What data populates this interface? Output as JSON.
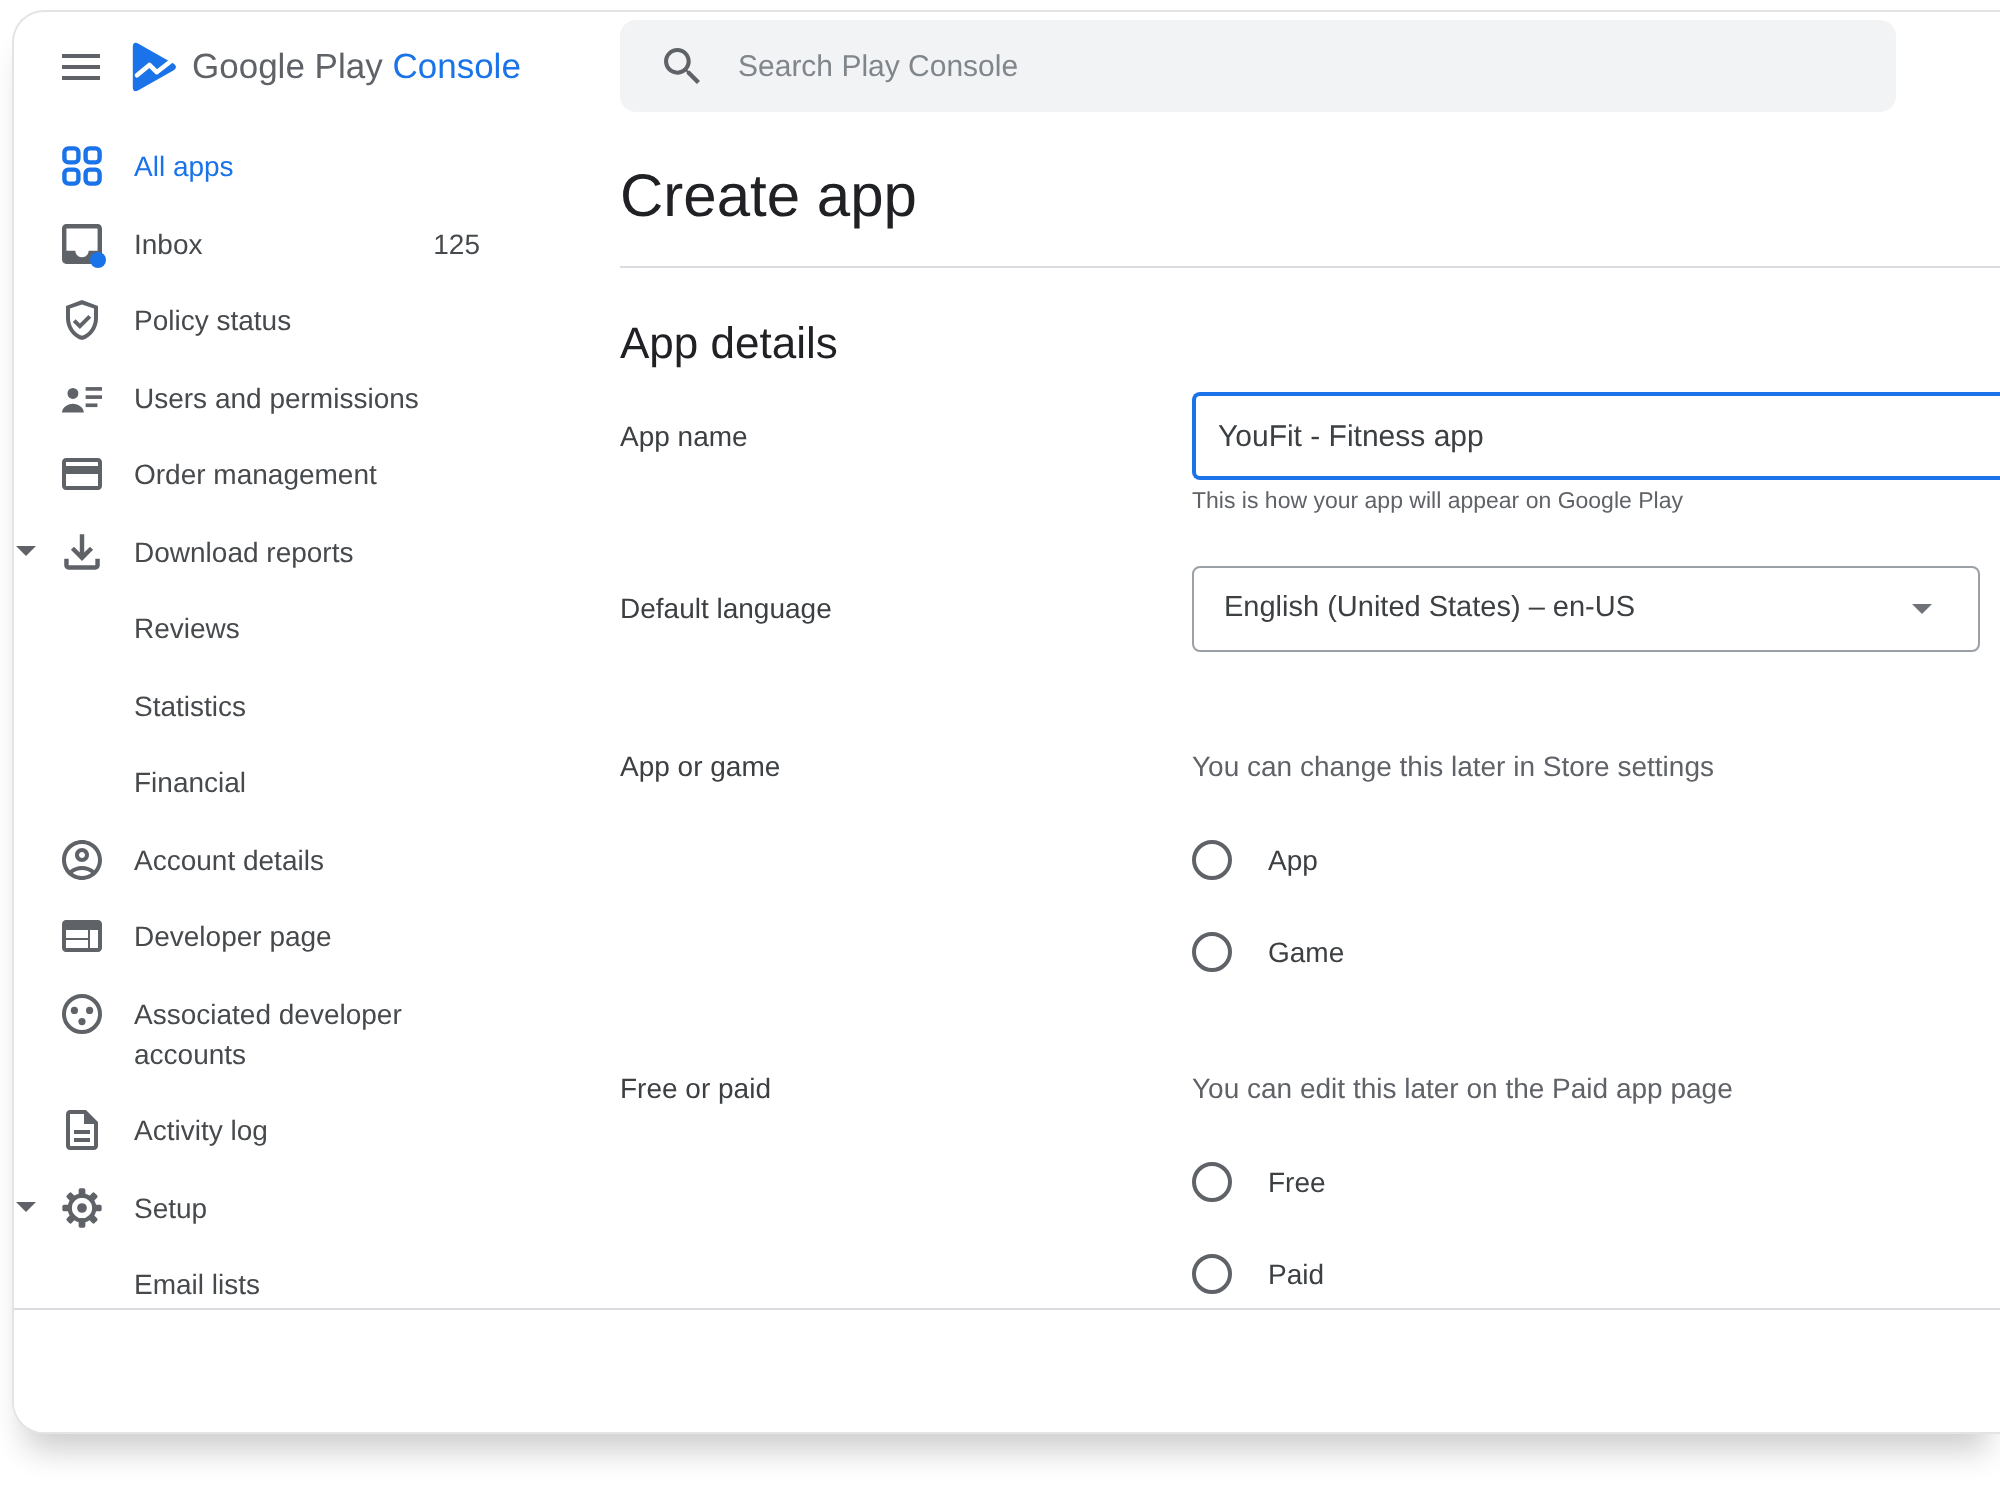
{
  "sidebar": {
    "logo": {
      "brand": "Google Play",
      "product": "Console"
    },
    "items": [
      {
        "label": "All apps",
        "selected": true
      },
      {
        "label": "Inbox",
        "selected": false,
        "count": "125",
        "unread_dot": true
      },
      {
        "label": "Policy status",
        "selected": false
      },
      {
        "label": "Users and permissions",
        "selected": false
      },
      {
        "label": "Order management",
        "selected": false
      },
      {
        "label": "Download reports",
        "selected": false,
        "expanded": true,
        "children": [
          {
            "label": "Reviews",
            "selected": false
          },
          {
            "label": "Statistics",
            "selected": false
          },
          {
            "label": "Financial",
            "selected": false
          }
        ]
      },
      {
        "label": "Account details",
        "selected": false
      },
      {
        "label": "Developer page",
        "selected": false
      },
      {
        "label": "Associated developer accounts",
        "selected": false
      },
      {
        "label": "Activity log",
        "selected": false
      },
      {
        "label": "Setup",
        "selected": false,
        "expanded": true,
        "children": [
          {
            "label": "Email lists",
            "selected": false
          }
        ]
      }
    ]
  },
  "search": {
    "placeholder": "Search Play Console"
  },
  "page": {
    "title": "Create app",
    "section_title": "App details"
  },
  "form": {
    "fields": [
      {
        "kind": "text",
        "label": "App name",
        "value": "YouFit - Fitness app",
        "hint": "This is how your app will appear on Google Play",
        "focused": true
      },
      {
        "kind": "select",
        "label": "Default language",
        "value": "English (United States) – en-US"
      },
      {
        "kind": "radio",
        "label": "App or game",
        "helper": "You can change this later in Store settings",
        "options": [
          {
            "label": "App",
            "selected": false
          },
          {
            "label": "Game",
            "selected": false
          }
        ]
      },
      {
        "kind": "radio",
        "label": "Free or paid",
        "helper": "You can edit this later on the Paid app page",
        "options": [
          {
            "label": "Free",
            "selected": false
          },
          {
            "label": "Paid",
            "selected": false
          }
        ]
      }
    ]
  }
}
